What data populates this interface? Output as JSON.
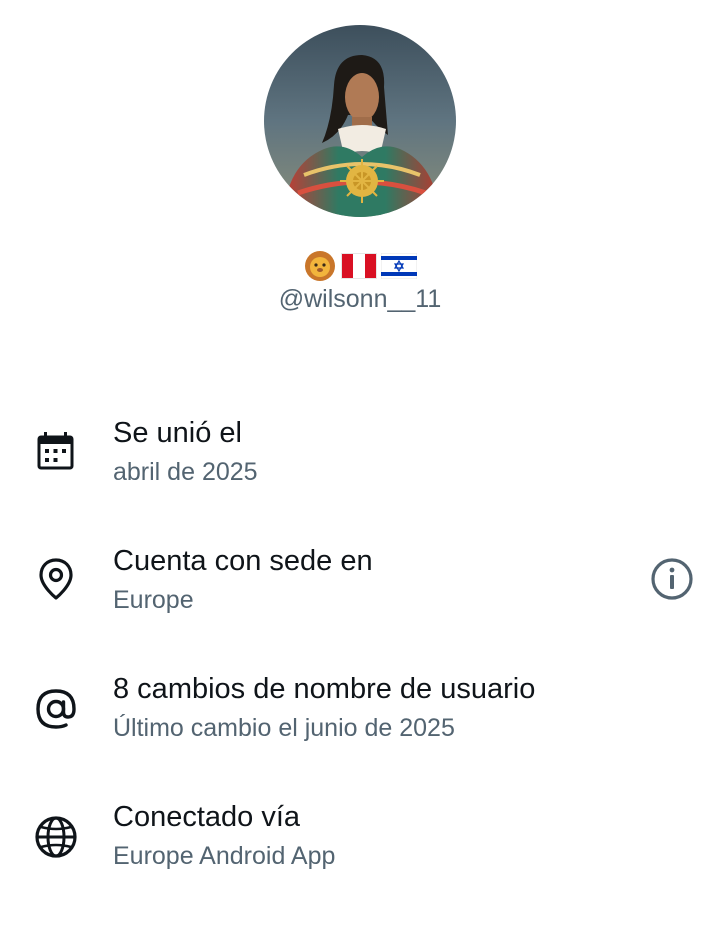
{
  "profile": {
    "avatar_alt": "profile-avatar",
    "display_name_emojis": [
      "lion-emoji",
      "peru-flag-emoji",
      "israel-flag-emoji"
    ],
    "handle": "@wilsonn__11"
  },
  "details": [
    {
      "icon": "calendar-icon",
      "title": "Se unió el",
      "subtitle": "abril de 2025"
    },
    {
      "icon": "location-pin-icon",
      "title": "Cuenta con sede en",
      "subtitle": "Europe"
    },
    {
      "icon": "at-sign-icon",
      "title": "8 cambios de nombre de usuario",
      "subtitle": "Último cambio el junio de 2025"
    },
    {
      "icon": "globe-icon",
      "title": "Conectado vía",
      "subtitle": "Europe Android App"
    }
  ],
  "colors": {
    "primary_text": "#0f1419",
    "secondary_text": "#536471",
    "background": "#ffffff"
  }
}
